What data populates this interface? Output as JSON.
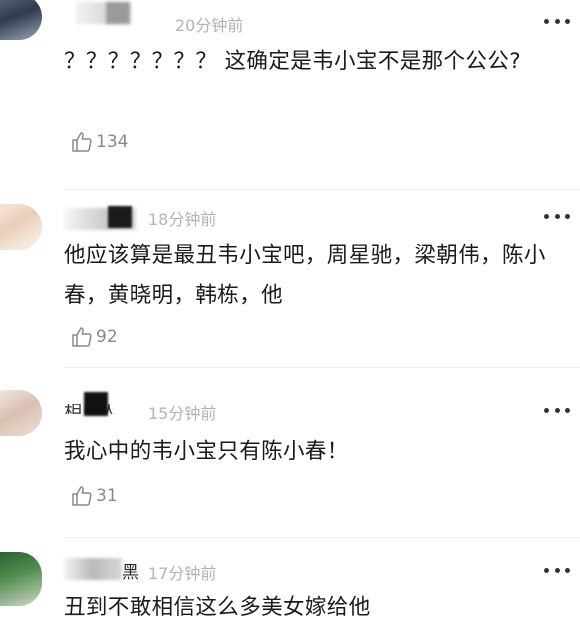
{
  "comments": [
    {
      "time": "20分钟前",
      "text": "？？？？？？？ 这确定是韦小宝不是那个公公?",
      "likes": "134"
    },
    {
      "time": "18分钟前",
      "text": "他应该算是最丑韦小宝吧，周星驰，梁朝伟，陈小春，黄晓明，韩栋，他",
      "likes": "92"
    },
    {
      "name_fragment": "相单人、",
      "time": "15分钟前",
      "text": "我心中的韦小宝只有陈小春！",
      "likes": "31"
    },
    {
      "name_fragment": "黑",
      "time": "17分钟前",
      "text": "丑到不敢相信这么多美女嫁给他"
    }
  ],
  "icons": {
    "like": "thumbs-up-icon",
    "more": "more-dots-icon"
  },
  "colors": {
    "time": "#b3b3b3",
    "like_count": "#8a8a8a",
    "text": "#1a1a1a"
  }
}
